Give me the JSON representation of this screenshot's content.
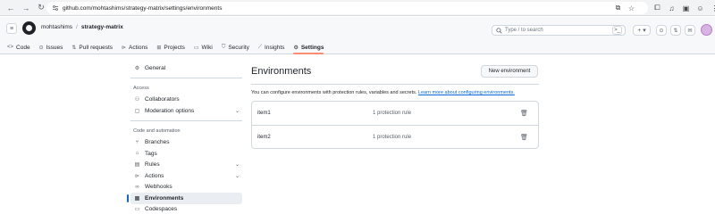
{
  "browser": {
    "url": "github.com/mohtashims/strategy-matrix/settings/environments"
  },
  "header": {
    "owner": "mohtashims",
    "separator": "/",
    "repo": "strategy-matrix",
    "search_placeholder": "Type / to search"
  },
  "repo_tabs": [
    {
      "label": "Code",
      "icon": "code-icon"
    },
    {
      "label": "Issues",
      "icon": "issue-icon"
    },
    {
      "label": "Pull requests",
      "icon": "pull-request-icon"
    },
    {
      "label": "Actions",
      "icon": "play-icon"
    },
    {
      "label": "Projects",
      "icon": "table-icon"
    },
    {
      "label": "Wiki",
      "icon": "book-icon"
    },
    {
      "label": "Security",
      "icon": "shield-icon"
    },
    {
      "label": "Insights",
      "icon": "graph-icon"
    },
    {
      "label": "Settings",
      "icon": "gear-icon",
      "active": true
    }
  ],
  "sidebar": {
    "general": "General",
    "access_heading": "Access",
    "collaborators": "Collaborators",
    "moderation": "Moderation options",
    "code_heading": "Code and automation",
    "branches": "Branches",
    "tags": "Tags",
    "rules": "Rules",
    "actions": "Actions",
    "webhooks": "Webhooks",
    "environments": "Environments",
    "codespaces": "Codespaces"
  },
  "main": {
    "title": "Environments",
    "new_button": "New environment",
    "description": "You can configure environments with protection rules, variables and secrets.",
    "learn_more": "Learn more about configuring environments.",
    "environments": [
      {
        "name": "item1",
        "rules": "1 protection rule"
      },
      {
        "name": "item2",
        "rules": "1 protection rule"
      }
    ]
  },
  "colors": {
    "accent": "#0969da",
    "active_tab_underline": "#fd8c73"
  }
}
